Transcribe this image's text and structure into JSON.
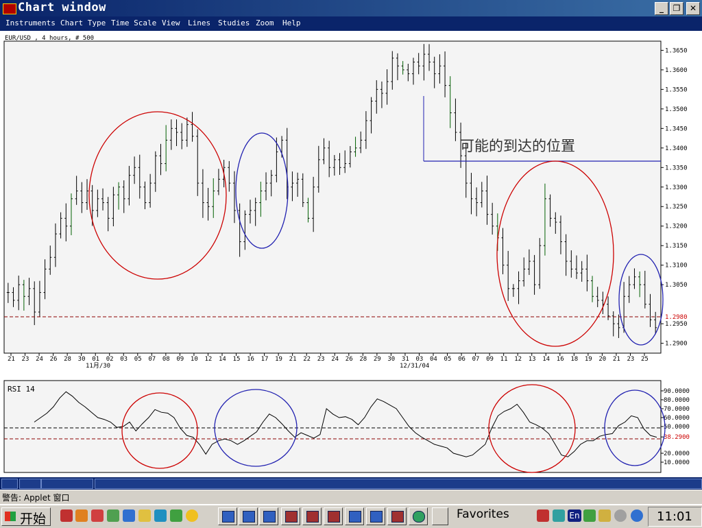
{
  "window": {
    "title": "Chart window"
  },
  "menu": {
    "items": [
      "Instruments",
      "Chart Type",
      "Time Scale",
      "View",
      "Lines",
      "Studies",
      "Zoom",
      "Help"
    ]
  },
  "price_panel": {
    "header": "EUR/USD , 4 hours, # 500",
    "annotation": "可能的到达的位置",
    "y_ticks": [
      "1.3650",
      "1.3600",
      "1.3550",
      "1.3500",
      "1.3450",
      "1.3400",
      "1.3350",
      "1.3300",
      "1.3250",
      "1.3200",
      "1.3150",
      "1.3100",
      "1.3050",
      "1.2980",
      "1.2950",
      "1.2900"
    ],
    "x_ticks": [
      "21",
      "23",
      "24",
      "26",
      "28",
      "30",
      "01",
      "02",
      "03",
      "05",
      "07",
      "08",
      "09",
      "10",
      "12",
      "14",
      "15",
      "16",
      "17",
      "19",
      "21",
      "22",
      "23",
      "24",
      "26",
      "28",
      "29",
      "30",
      "31",
      "03",
      "04",
      "05",
      "06",
      "07",
      "09",
      "11",
      "12",
      "13",
      "14",
      "16",
      "18",
      "19",
      "20",
      "21",
      "23",
      "25"
    ],
    "x_sublabels": [
      "11月/30",
      "12/31/04"
    ],
    "highlight_value": "1.2980"
  },
  "rsi_panel": {
    "title": "RSI 14",
    "y_ticks": [
      "90.0000",
      "80.0000",
      "70.0000",
      "60.0000",
      "50.0000",
      "38.2900",
      "20.0000",
      "10.0000"
    ],
    "highlight_value": "38.2900"
  },
  "statusbar": {
    "text": "警告: Applet 窗口"
  },
  "taskbar": {
    "start_label": "开始",
    "favorites_label": "Favorites",
    "lang": "En",
    "clock": "11:01"
  },
  "colors": {
    "bars": "#000000",
    "up_accent": "#008000",
    "red_circles": "#cc0000",
    "blue_circles": "#2020b0",
    "dashed_line": "#8b0000",
    "titlebar": "#0a246a"
  },
  "chart_data": [
    {
      "type": "bar",
      "subtype": "ohlc",
      "title": "EUR/USD , 4 hours, # 500",
      "ylim": [
        1.288,
        1.367
      ],
      "close_series": [
        1.303,
        1.301,
        1.305,
        1.302,
        1.304,
        1.298,
        1.303,
        1.309,
        1.312,
        1.318,
        1.322,
        1.32,
        1.327,
        1.329,
        1.326,
        1.329,
        1.324,
        1.327,
        1.326,
        1.322,
        1.328,
        1.33,
        1.327,
        1.333,
        1.335,
        1.33,
        1.326,
        1.331,
        1.338,
        1.336,
        1.342,
        1.345,
        1.344,
        1.342,
        1.346,
        1.343,
        1.331,
        1.326,
        1.325,
        1.329,
        1.332,
        1.335,
        1.331,
        1.324,
        1.316,
        1.323,
        1.324,
        1.326,
        1.329,
        1.331,
        1.333,
        1.339,
        1.342,
        1.33,
        1.331,
        1.332,
        1.326,
        1.322,
        1.33,
        1.337,
        1.34,
        1.335,
        1.337,
        1.335,
        1.336,
        1.339,
        1.34,
        1.342,
        1.347,
        1.352,
        1.355,
        1.354,
        1.357,
        1.363,
        1.361,
        1.36,
        1.359,
        1.362,
        1.361,
        1.364,
        1.362,
        1.359,
        1.361,
        1.356,
        1.349,
        1.344,
        1.338,
        1.331,
        1.327,
        1.326,
        1.329,
        1.323,
        1.32,
        1.317,
        1.31,
        1.304,
        1.304,
        1.306,
        1.309,
        1.311,
        1.305,
        1.315,
        1.327,
        1.322,
        1.321,
        1.316,
        1.311,
        1.309,
        1.308,
        1.309,
        1.306,
        1.302,
        1.301,
        1.3,
        1.297,
        1.295,
        1.294,
        1.302,
        1.305,
        1.307,
        1.305,
        1.3,
        1.296,
        1.294
      ],
      "reference_lines": [
        1.298,
        1.339
      ]
    },
    {
      "type": "line",
      "title": "RSI 14",
      "ylim": [
        0,
        100
      ],
      "values": [
        55,
        60,
        65,
        72,
        82,
        89,
        84,
        77,
        72,
        66,
        60,
        58,
        55,
        49,
        50,
        55,
        45,
        53,
        60,
        69,
        66,
        65,
        60,
        48,
        40,
        38,
        30,
        19,
        30,
        34,
        36,
        34,
        30,
        34,
        39,
        44,
        55,
        64,
        60,
        53,
        45,
        38,
        43,
        40,
        37,
        41,
        70,
        64,
        60,
        61,
        58,
        52,
        60,
        72,
        81,
        78,
        74,
        70,
        60,
        50,
        43,
        38,
        34,
        30,
        28,
        26,
        20,
        18,
        16,
        18,
        24,
        30,
        48,
        62,
        67,
        70,
        75,
        66,
        55,
        52,
        48,
        42,
        30,
        18,
        16,
        22,
        30,
        34,
        34,
        39,
        41,
        42,
        51,
        55,
        62,
        60,
        47,
        40,
        38
      ]
    }
  ]
}
